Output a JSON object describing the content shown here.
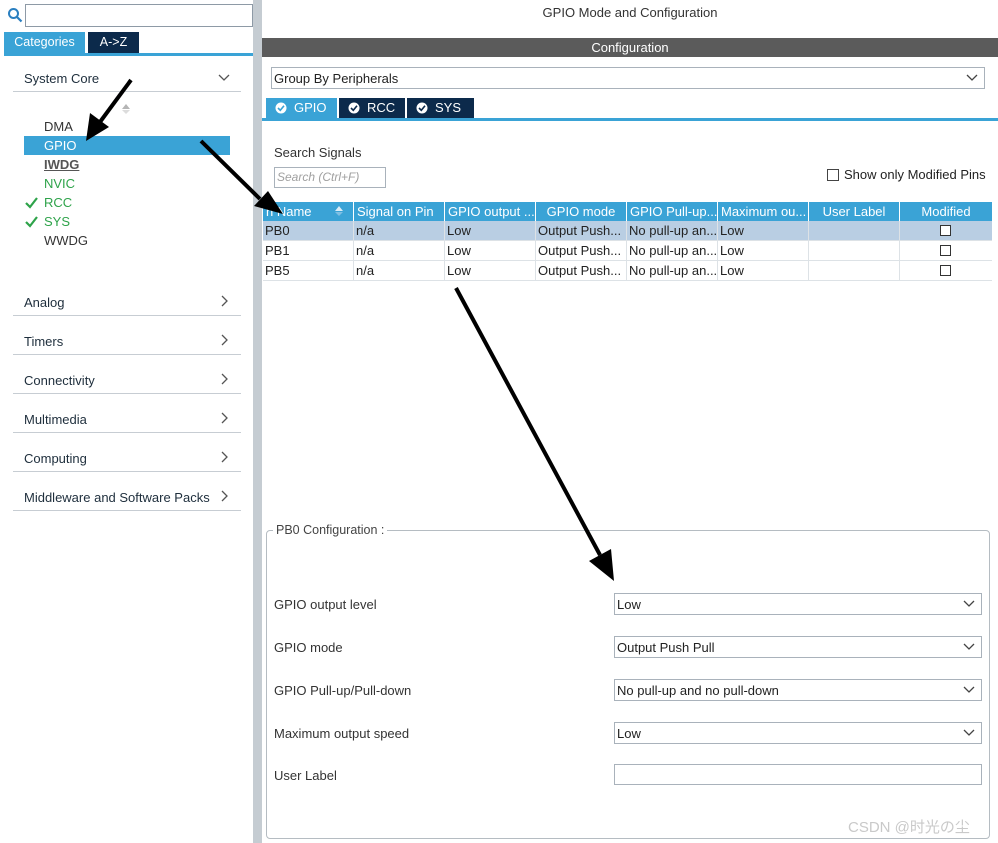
{
  "left_panel": {
    "search": {
      "value": "",
      "placeholder": ""
    },
    "tabs": [
      {
        "label": "Categories"
      },
      {
        "label": "A->Z"
      }
    ],
    "categories": [
      {
        "label": "System Core"
      },
      {
        "label": "Analog"
      },
      {
        "label": "Timers"
      },
      {
        "label": "Connectivity"
      },
      {
        "label": "Multimedia"
      },
      {
        "label": "Computing"
      },
      {
        "label": "Middleware and Software Packs"
      }
    ],
    "system_core_items": [
      {
        "label": "DMA"
      },
      {
        "label": "GPIO"
      },
      {
        "label": "IWDG"
      },
      {
        "label": "NVIC"
      },
      {
        "label": "RCC"
      },
      {
        "label": "SYS"
      },
      {
        "label": "WWDG"
      }
    ]
  },
  "right_panel": {
    "title": "GPIO Mode and Configuration",
    "config_bar": "Configuration",
    "group_by": "Group By Peripherals",
    "peripheral_tabs": [
      {
        "label": "GPIO"
      },
      {
        "label": "RCC"
      },
      {
        "label": "SYS"
      }
    ],
    "search_signals_label": "Search Signals",
    "search_placeholder": "Search (Ctrl+F)",
    "show_modified_label": "Show only Modified Pins",
    "table": {
      "headers": [
        "n Name",
        "Signal on Pin",
        "GPIO output ...",
        "GPIO mode",
        "GPIO Pull-up...",
        "Maximum ou...",
        "User Label",
        "Modified"
      ],
      "rows": [
        [
          "PB0",
          "n/a",
          "Low",
          "Output Push...",
          "No pull-up an...",
          "Low",
          "",
          ""
        ],
        [
          "PB1",
          "n/a",
          "Low",
          "Output Push...",
          "No pull-up an...",
          "Low",
          "",
          ""
        ],
        [
          "PB5",
          "n/a",
          "Low",
          "Output Push...",
          "No pull-up an...",
          "Low",
          "",
          ""
        ]
      ]
    },
    "pb0_config": {
      "title": "PB0 Configuration :",
      "fields": [
        {
          "label": "GPIO output level",
          "value": "Low"
        },
        {
          "label": "GPIO mode",
          "value": "Output Push Pull"
        },
        {
          "label": "GPIO Pull-up/Pull-down",
          "value": "No pull-up and no pull-down"
        },
        {
          "label": "Maximum output speed",
          "value": "Low"
        },
        {
          "label": "User Label",
          "value": ""
        }
      ]
    }
  },
  "watermark": "CSDN @时光の尘",
  "colors": {
    "accent": "#3aa3d6",
    "dark_tab": "#0c2a4b",
    "check_green": "#2ea34a"
  }
}
